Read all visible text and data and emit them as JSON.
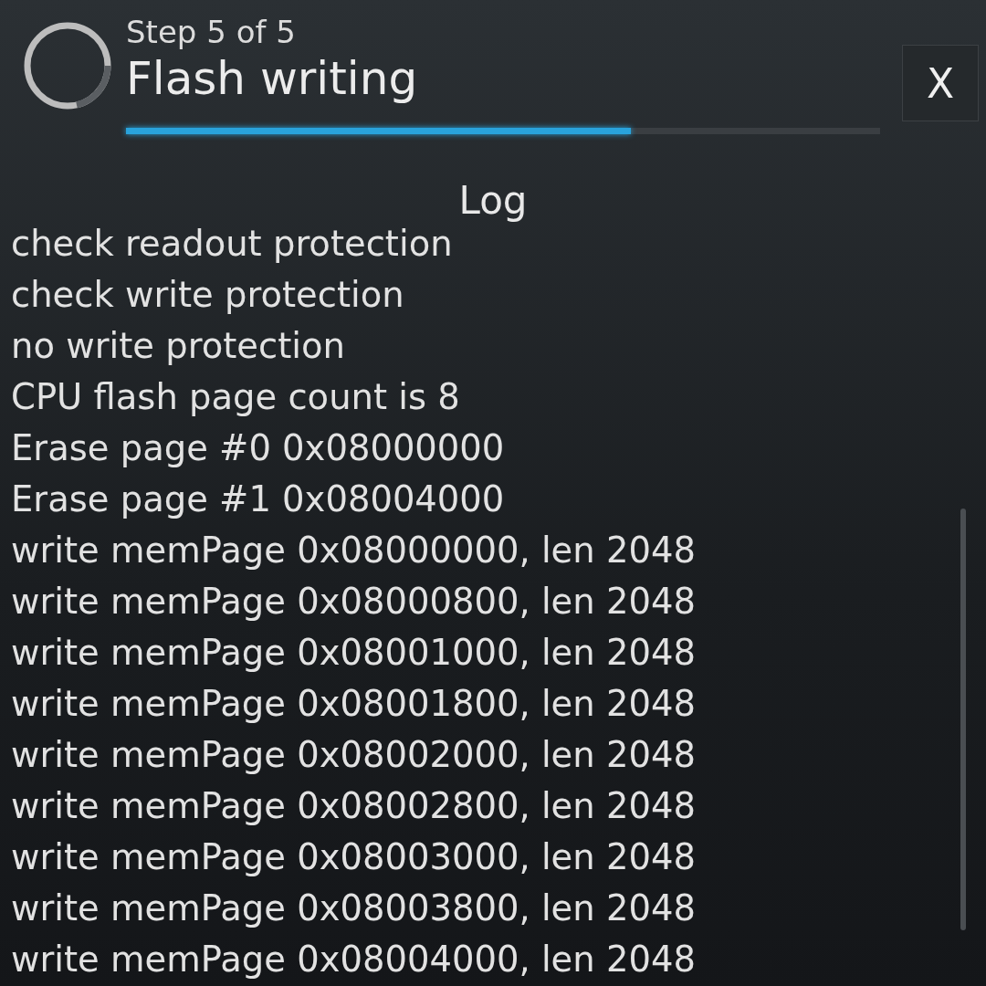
{
  "header": {
    "step": "Step 5 of 5",
    "title": "Flash writing",
    "progress": {
      "level": 0.67
    },
    "close_label": "X"
  },
  "log": {
    "title": "Log",
    "lines": [
      "check readout protection",
      "check write protection",
      "no write protection",
      "CPU flash page count is 8",
      "Erase page #0 0x08000000",
      "Erase page #1 0x08004000",
      "write memPage 0x08000000, len 2048",
      "write memPage 0x08000800, len 2048",
      "write memPage 0x08001000, len 2048",
      "write memPage 0x08001800, len 2048",
      "write memPage 0x08002000, len 2048",
      "write memPage 0x08002800, len 2048",
      "write memPage 0x08003000, len 2048",
      "write memPage 0x08003800, len 2048",
      "write memPage 0x08004000, len 2048"
    ]
  }
}
